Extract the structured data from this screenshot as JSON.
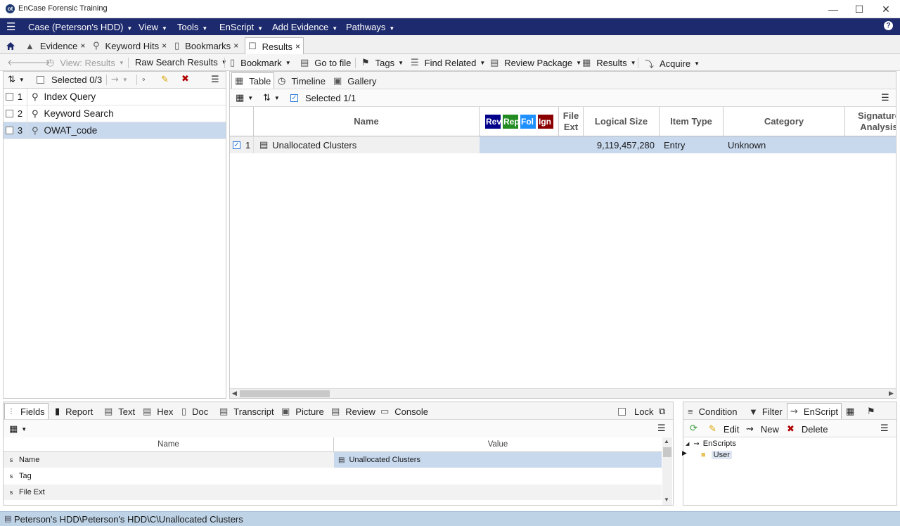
{
  "app": {
    "title": "EnCase Forensic Training",
    "logo": "ot"
  },
  "menu": {
    "items": [
      "Case (Peterson's HDD)",
      "View",
      "Tools",
      "EnScript",
      "Add Evidence",
      "Pathways"
    ],
    "help": "?"
  },
  "tabs": [
    {
      "label": "Evidence",
      "close": "×"
    },
    {
      "label": "Keyword Hits",
      "close": "×"
    },
    {
      "label": "Bookmarks",
      "close": "×"
    },
    {
      "label": "Results",
      "close": "×"
    }
  ],
  "toolbar": {
    "view": "View: Results",
    "raw": "Raw Search Results",
    "bookmark": "Bookmark",
    "goto": "Go to file",
    "tags": "Tags",
    "find_related": "Find Related",
    "review_package": "Review Package",
    "results": "Results",
    "acquire": "Acquire"
  },
  "left_pane": {
    "selected": "Selected 0/3",
    "items": [
      {
        "num": "1",
        "label": "Index Query",
        "icon": "search-icon"
      },
      {
        "num": "2",
        "label": "Keyword Search",
        "icon": "search-icon"
      },
      {
        "num": "3",
        "label": "OWAT_code",
        "icon": "key-icon"
      }
    ]
  },
  "view_tabs": [
    "Table",
    "Timeline",
    "Gallery"
  ],
  "table": {
    "selected": "Selected 1/1",
    "columns": [
      "Name",
      "File Ext",
      "Logical Size",
      "Item Type",
      "Category",
      "Signature Analysis"
    ],
    "badges": [
      {
        "label": "Rev",
        "color": "#00008b"
      },
      {
        "label": "Rep",
        "color": "#228b22"
      },
      {
        "label": "Fol",
        "color": "#1e90ff"
      },
      {
        "label": "Ign",
        "color": "#8b0000"
      }
    ],
    "rows": [
      {
        "num": "1",
        "name": "Unallocated Clusters",
        "ext": "",
        "size": "9,119,457,280",
        "type": "Entry",
        "category": "Unknown"
      }
    ]
  },
  "bottom": {
    "tabs": [
      "Fields",
      "Report",
      "Text",
      "Hex",
      "Doc",
      "Transcript",
      "Picture",
      "Review",
      "Console"
    ],
    "lock": "Lock",
    "columns": [
      "Name",
      "Value"
    ],
    "rows": [
      {
        "type": "s",
        "name": "Name",
        "value": "Unallocated Clusters"
      },
      {
        "type": "s",
        "name": "Tag",
        "value": ""
      },
      {
        "type": "s",
        "name": "File Ext",
        "value": ""
      }
    ]
  },
  "br": {
    "tabs": [
      "Condition",
      "Filter",
      "EnScript"
    ],
    "edit": "Edit",
    "new": "New",
    "delete": "Delete",
    "tree_root": "EnScripts",
    "tree_child": "User"
  },
  "status": {
    "path": "Peterson's HDD\\Peterson's HDD\\C\\Unallocated Clusters"
  },
  "colors": {
    "menubar": "#1d2a6d",
    "selection": "#c8d9ee",
    "statusbar": "#bed3e6"
  }
}
